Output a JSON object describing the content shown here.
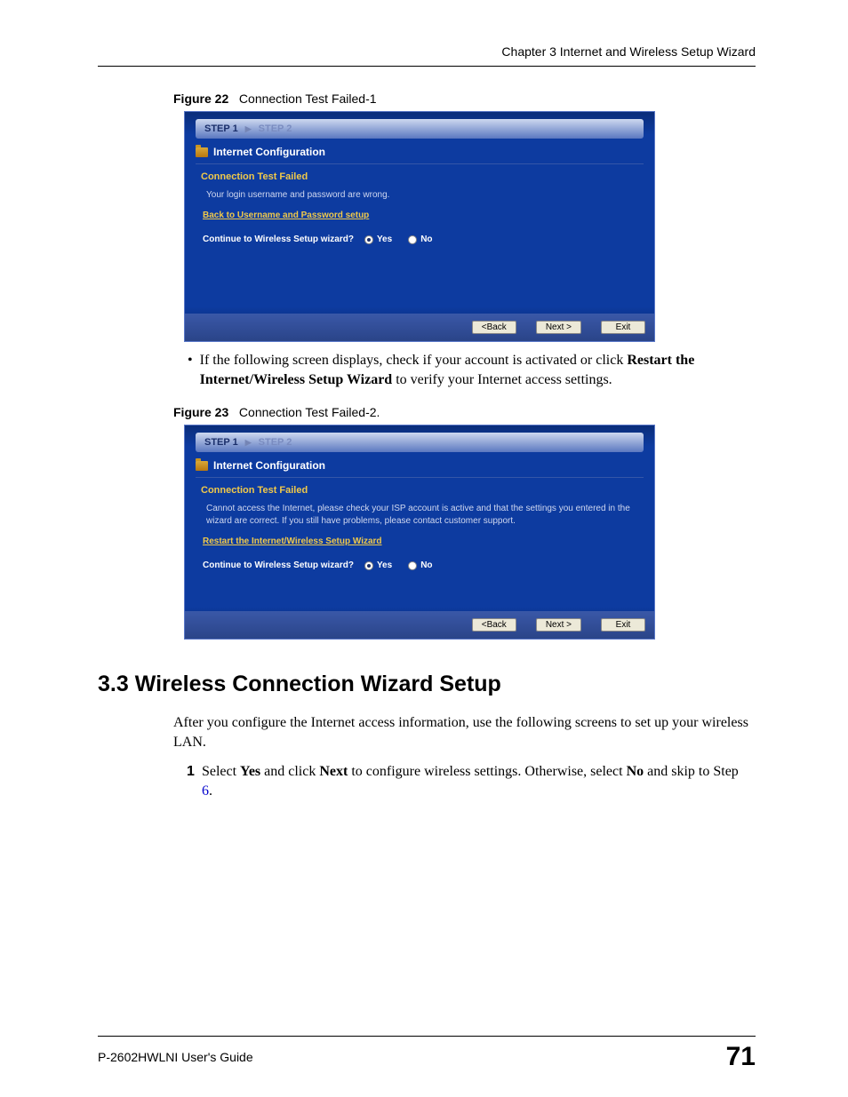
{
  "header": {
    "chapter": "Chapter 3 Internet and Wireless Setup Wizard"
  },
  "figure22": {
    "label": "Figure 22",
    "title": "Connection Test Failed-1",
    "steps": {
      "s1": "STEP 1",
      "s2": "STEP 2"
    },
    "section": "Internet Configuration",
    "failed": "Connection Test Failed",
    "msg": "Your login username and password are wrong.",
    "link": "Back to Username and Password setup",
    "continueLabel": "Continue to Wireless Setup wizard?",
    "yes": "Yes",
    "no": "No",
    "back": "<Back",
    "next": "Next >",
    "exit": "Exit"
  },
  "bullet1": {
    "pre": "If the following screen displays, check if your account is activated or click ",
    "bold1": "Restart the Internet/Wireless Setup Wizard",
    "post": " to verify your Internet access settings."
  },
  "figure23": {
    "label": "Figure 23",
    "title": "Connection Test Failed-2.",
    "steps": {
      "s1": "STEP 1",
      "s2": "STEP 2"
    },
    "section": "Internet Configuration",
    "failed": "Connection Test Failed",
    "msg": "Cannot access the Internet, please check your ISP account is active and that the settings you entered in the wizard are correct. If you still have problems, please contact customer support.",
    "link": "Restart the Internet/Wireless Setup Wizard",
    "continueLabel": "Continue to Wireless Setup wizard?",
    "yes": "Yes",
    "no": "No",
    "back": "<Back",
    "next": "Next >",
    "exit": "Exit"
  },
  "section33": {
    "heading": "3.3  Wireless Connection Wizard Setup",
    "intro": "After you configure the Internet access information, use the following screens to set up your wireless LAN.",
    "item1": {
      "num": "1",
      "pre": "Select ",
      "b1": "Yes",
      "mid1": " and click ",
      "b2": "Next",
      "mid2": " to configure wireless settings. Otherwise, select ",
      "b3": "No",
      "mid3": " and skip to Step ",
      "step": "6",
      "tail": "."
    }
  },
  "footer": {
    "guide": "P-2602HWLNI User's Guide",
    "page": "71"
  }
}
